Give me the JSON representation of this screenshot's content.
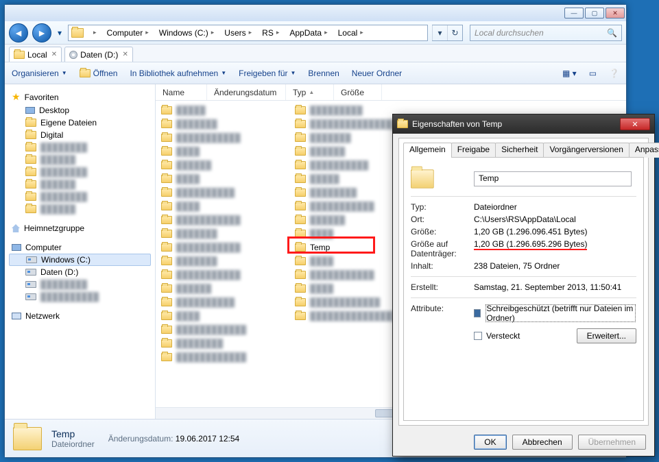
{
  "window": {
    "min": "—",
    "max": "▢",
    "close": "✕",
    "search_placeholder": "Local durchsuchen"
  },
  "breadcrumbs": [
    "Computer",
    "Windows (C:)",
    "Users",
    "RS",
    "AppData",
    "Local"
  ],
  "tabs": [
    {
      "icon": "folder",
      "label": "Local"
    },
    {
      "icon": "disc",
      "label": "Daten (D:)"
    }
  ],
  "toolbar": {
    "organize": "Organisieren",
    "open": "Öffnen",
    "library": "In Bibliothek aufnehmen",
    "share": "Freigeben für",
    "burn": "Brennen",
    "newfolder": "Neuer Ordner"
  },
  "columns": {
    "name": "Name",
    "date": "Änderungsdatum",
    "type": "Typ",
    "size": "Größe"
  },
  "nav": {
    "favorites": "Favoriten",
    "fav_items": [
      "Desktop",
      "Eigene Dateien",
      "Digital"
    ],
    "homegroup": "Heimnetzgruppe",
    "computer": "Computer",
    "drives": [
      "Windows (C:)",
      "Daten (D:)"
    ],
    "network": "Netzwerk"
  },
  "temp_label": "Temp",
  "details": {
    "title": "Temp",
    "subtitle": "Dateiordner",
    "date_label": "Änderungsdatum:",
    "date_value": "19.06.2017 12:54"
  },
  "dialog": {
    "title": "Eigenschaften von Temp",
    "tabs": [
      "Allgemein",
      "Freigabe",
      "Sicherheit",
      "Vorgängerversionen",
      "Anpassen"
    ],
    "name": "Temp",
    "rows": {
      "type_k": "Typ:",
      "type_v": "Dateiordner",
      "loc_k": "Ort:",
      "loc_v": "C:\\Users\\RS\\AppData\\Local",
      "size_k": "Größe:",
      "size_v": "1,20 GB (1.296.096.451 Bytes)",
      "disk_k": "Größe auf Datenträger:",
      "disk_v": "1,20 GB (1.296.695.296 Bytes)",
      "cont_k": "Inhalt:",
      "cont_v": "238 Dateien, 75 Ordner",
      "created_k": "Erstellt:",
      "created_v": "Samstag, 21. September 2013, 11:50:41",
      "attr_k": "Attribute:",
      "ro": "Schreibgeschützt (betrifft nur Dateien im Ordner)",
      "hidden": "Versteckt",
      "advanced": "Erweitert..."
    },
    "buttons": {
      "ok": "OK",
      "cancel": "Abbrechen",
      "apply": "Übernehmen"
    }
  }
}
